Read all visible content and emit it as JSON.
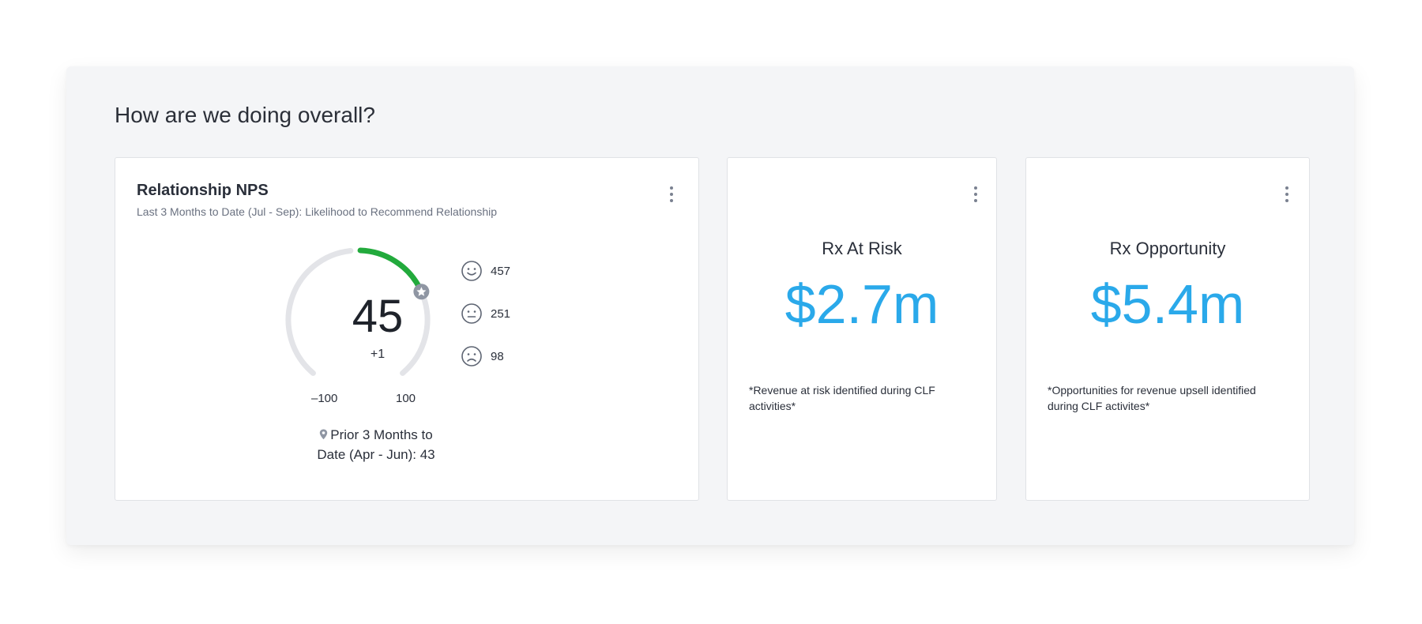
{
  "section": {
    "title": "How are we doing overall?"
  },
  "nps_card": {
    "title": "Relationship NPS",
    "subtitle": "Last 3 Months to Date (Jul - Sep): Likelihood to Recommend Relationship",
    "score": "45",
    "delta": "+1",
    "gauge_fill_fraction": 0.725,
    "gauge_min_label": "–100",
    "gauge_max_label": "100",
    "marker_icon": "star-badge-icon",
    "legend": [
      {
        "icon": "smile-icon",
        "value": "457"
      },
      {
        "icon": "neutral-face-icon",
        "value": "251"
      },
      {
        "icon": "frown-icon",
        "value": "98"
      }
    ],
    "prior_line1": "Prior 3 Months to",
    "prior_line2": "Date (Apr - Jun): 43",
    "colors": {
      "gauge_track": "#e3e4e8",
      "gauge_fill": "#22aa3c",
      "marker": "#8f96a3"
    }
  },
  "risk_card": {
    "label": "Rx At Risk",
    "value": "$2.7m",
    "note": "*Revenue at risk identified during CLF activities*"
  },
  "opportunity_card": {
    "label": "Rx Opportunity",
    "value": "$5.4m",
    "note": "*Opportunities for revenue upsell identified during CLF activites*"
  },
  "colors": {
    "accent": "#2aa9ea",
    "panel_bg": "#f4f5f7",
    "menu_icon": "#7a8190"
  }
}
